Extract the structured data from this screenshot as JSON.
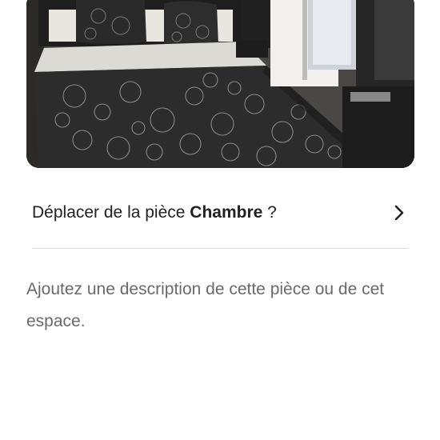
{
  "photo": {
    "alt": "",
    "icon": "bedroom-photo"
  },
  "move_room": {
    "prefix": "Déplacer de la pièce ",
    "room": "Chambre",
    "suffix": " ?",
    "icon": "chevron-right-icon"
  },
  "description": {
    "placeholder": "Ajoutez une description de cette pièce ou de cet espace."
  },
  "colors": {
    "text_primary": "#222222",
    "text_secondary": "#6a6a6a",
    "divider": "#dddddd"
  }
}
